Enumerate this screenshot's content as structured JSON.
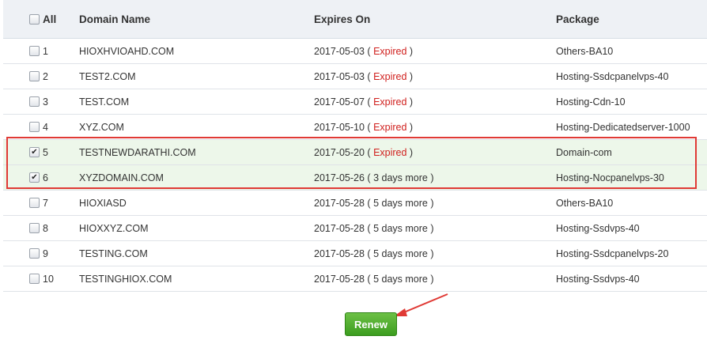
{
  "header": {
    "all_label": "All",
    "domain_label": "Domain Name",
    "expires_label": "Expires On",
    "package_label": "Package"
  },
  "rows": [
    {
      "num": "1",
      "domain": "HIOXHVIOAHD.COM",
      "date": "2017-05-03",
      "status": "Expired",
      "expired": true,
      "package": "Others-BA10",
      "checked": false
    },
    {
      "num": "2",
      "domain": "TEST2.COM",
      "date": "2017-05-03",
      "status": "Expired",
      "expired": true,
      "package": "Hosting-Ssdcpanelvps-40",
      "checked": false
    },
    {
      "num": "3",
      "domain": "TEST.COM",
      "date": "2017-05-07",
      "status": "Expired",
      "expired": true,
      "package": "Hosting-Cdn-10",
      "checked": false
    },
    {
      "num": "4",
      "domain": "XYZ.COM",
      "date": "2017-05-10",
      "status": "Expired",
      "expired": true,
      "package": "Hosting-Dedicatedserver-1000",
      "checked": false
    },
    {
      "num": "5",
      "domain": "TESTNEWDARATHI.COM",
      "date": "2017-05-20",
      "status": "Expired",
      "expired": true,
      "package": "Domain-com",
      "checked": true
    },
    {
      "num": "6",
      "domain": "XYZDOMAIN.COM",
      "date": "2017-05-26",
      "status": "3 days more",
      "expired": false,
      "package": "Hosting-Nocpanelvps-30",
      "checked": true
    },
    {
      "num": "7",
      "domain": "HIOXIASD",
      "date": "2017-05-28",
      "status": "5 days more",
      "expired": false,
      "package": "Others-BA10",
      "checked": false
    },
    {
      "num": "8",
      "domain": "HIOXXYZ.COM",
      "date": "2017-05-28",
      "status": "5 days more",
      "expired": false,
      "package": "Hosting-Ssdvps-40",
      "checked": false
    },
    {
      "num": "9",
      "domain": "TESTING.COM",
      "date": "2017-05-28",
      "status": "5 days more",
      "expired": false,
      "package": "Hosting-Ssdcpanelvps-20",
      "checked": false
    },
    {
      "num": "10",
      "domain": "TESTINGHIOX.COM",
      "date": "2017-05-28",
      "status": "5 days more",
      "expired": false,
      "package": "Hosting-Ssdvps-40",
      "checked": false
    }
  ],
  "renew_label": "Renew",
  "colors": {
    "expired": "#d0201e",
    "highlight": "#e03a35",
    "button": "#4caf30",
    "selected_row": "#edf7ea"
  }
}
